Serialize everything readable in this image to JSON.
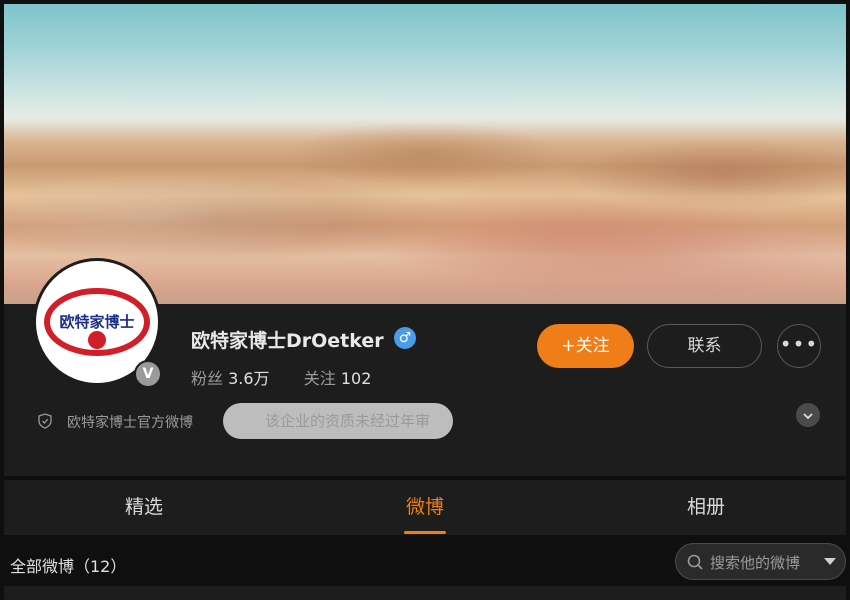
{
  "profile": {
    "avatar_text": "欧特家博士",
    "verified_badge": "V",
    "name": "欧特家博士DrOetker",
    "gender_icon": "♂",
    "fans_label": "粉丝",
    "fans_count": "3.6万",
    "follow_label": "关注",
    "follow_count": "102",
    "official_text": "欧特家博士官方微博",
    "qualification_text": "该企业的资质未经过年审"
  },
  "actions": {
    "follow_button": "+关注",
    "contact_button": "联系",
    "more_button": "•••"
  },
  "tabs": [
    {
      "label": "精选"
    },
    {
      "label": "微博",
      "active": true
    },
    {
      "label": "相册"
    }
  ],
  "feed": {
    "title": "全部微博（12）",
    "search_placeholder": "搜索他的微博"
  },
  "colors": {
    "accent": "#ef7d18",
    "panel": "#1d1d1d",
    "brand_red": "#d11f2a",
    "brand_blue": "#1a2f8a",
    "gender_blue": "#4a9ce8"
  },
  "icons": [
    "shield-icon",
    "search-icon",
    "chevron-down-icon",
    "male-icon",
    "verified-icon",
    "more-icon"
  ]
}
